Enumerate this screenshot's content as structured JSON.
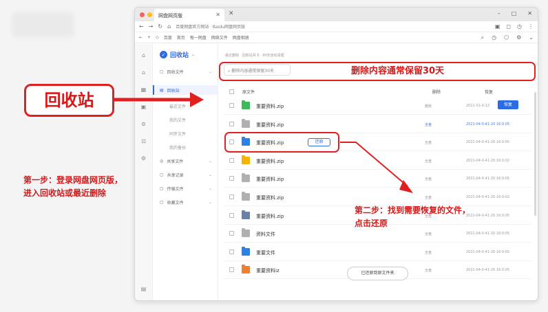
{
  "browser": {
    "tab_title": "网盘网页版",
    "url": "百度网盘官方网站 · Baidu网盘网页版",
    "bookmarks": [
      "百度",
      "首页",
      "每一网盘",
      "网络文件",
      "网盘相册"
    ]
  },
  "sidebar": {
    "title": "回收站",
    "items": [
      {
        "label": "回收文件"
      },
      {
        "label": "回收站"
      },
      {
        "label": "最近文件"
      },
      {
        "label": "我的文件"
      },
      {
        "label": "同步文件"
      },
      {
        "label": "我的备份"
      },
      {
        "label": "共享文件"
      },
      {
        "label": "共享记录"
      },
      {
        "label": "传输文件"
      },
      {
        "label": "收藏文件"
      }
    ]
  },
  "main": {
    "breadcrumb": "最近删除 · 回收站共 6 · 90天自动清理",
    "search_placeholder": "删除内容通常保留30天",
    "columns": {
      "name": "原文件",
      "source": "删除",
      "restore": "恢复"
    },
    "restore_label": "恢复",
    "restore_inline_label": "还原",
    "toast": "已还原到原文件夹",
    "rows": [
      {
        "name": "重要资料.zip",
        "source": "删除",
        "date": "2021-01-0-12",
        "color": "#3dbb5b",
        "blue": false
      },
      {
        "name": "重要资料.zip",
        "source": "全盘",
        "date": "2021-04-0-41-20 16:0:05",
        "color": "#b0b0b0",
        "blue": true
      },
      {
        "name": "重要资料.zip",
        "source": "全盘",
        "date": "2021-04-0-41-20 16:0:05",
        "color": "#2b82e6",
        "blue": false
      },
      {
        "name": "重要资料.zip",
        "source": "全盘",
        "date": "2021-04-0-41-20 16:0:02",
        "color": "#f4b400",
        "blue": false
      },
      {
        "name": "重要资料.zip",
        "source": "全盘",
        "date": "2021-04-0-41-20 16:0:05",
        "color": "#b0b0b0",
        "blue": false
      },
      {
        "name": "重要资料.zip",
        "source": "全盘",
        "date": "2021-04-0-41-20 16:0:02",
        "color": "#b0b0b0",
        "blue": false
      },
      {
        "name": "重要资料.zip",
        "source": "全盘",
        "date": "2021-04-0-41-20 16:0:05",
        "color": "#6b7fa8",
        "blue": false
      },
      {
        "name": "资料文件",
        "source": "全盘",
        "date": "2021-04-0-41-20 16:0:05",
        "color": "#b0b0b0",
        "blue": false
      },
      {
        "name": "重要文件",
        "source": "全盘",
        "date": "2021-04-0-41-20 16:0:05",
        "color": "#2b82e6",
        "blue": false
      },
      {
        "name": "重要资料iz",
        "source": "全盘",
        "date": "2021-04-0-41-20 16:0:05",
        "color": "#f08030",
        "blue": false
      }
    ]
  },
  "annotations": {
    "callout": "回收站",
    "search_note": "删除内容通常保留30天",
    "step1": [
      "第一步：登录网盘网页版，",
      "进入回收站或最近删除"
    ],
    "step2": [
      "第二步：找到需要恢复的文件，",
      "点击还原"
    ]
  },
  "colors": {
    "accent": "#2b6be6",
    "annotation": "#e02020"
  }
}
